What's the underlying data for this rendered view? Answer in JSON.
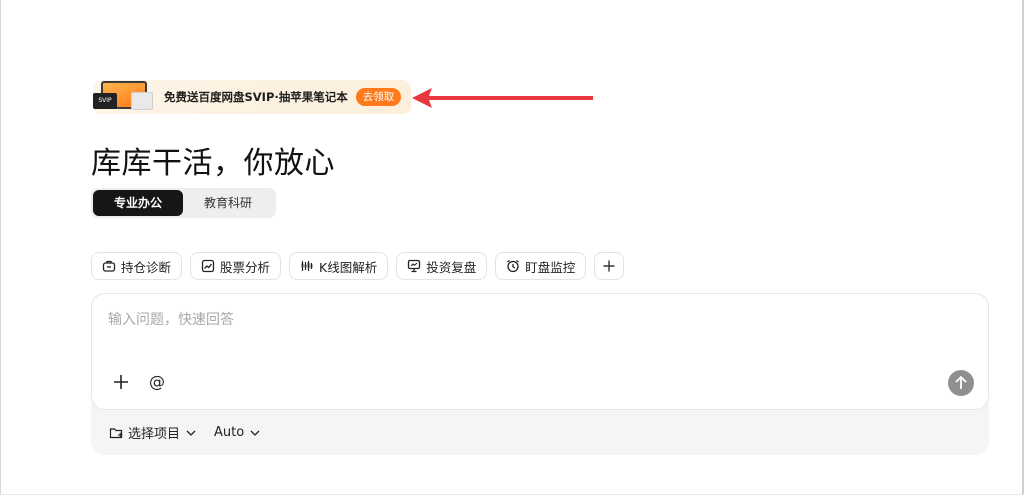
{
  "promo": {
    "art_card_text": "SVIP",
    "text": "免费送百度网盘SVIP·抽苹果笔记本",
    "button": "去领取"
  },
  "hero": {
    "title": "库库干活，你放心"
  },
  "mode_tabs": [
    {
      "label": "专业办公",
      "active": true
    },
    {
      "label": "教育科研",
      "active": false
    }
  ],
  "chips": [
    {
      "label": "持仓诊断",
      "icon": "briefcase-icon"
    },
    {
      "label": "股票分析",
      "icon": "chart-icon"
    },
    {
      "label": "K线图解析",
      "icon": "candlestick-icon"
    },
    {
      "label": "投资复盘",
      "icon": "presentation-icon"
    },
    {
      "label": "盯盘监控",
      "icon": "alarm-clock-icon"
    }
  ],
  "input": {
    "placeholder": "输入问题，快速回答",
    "value": ""
  },
  "footer": {
    "project_select": "选择项目",
    "model_select": "Auto"
  },
  "colors": {
    "accent": "#ff7a1a",
    "annotation_arrow": "#e8383d",
    "active_tab": "#161616",
    "send_button": "#8f8f8f"
  }
}
